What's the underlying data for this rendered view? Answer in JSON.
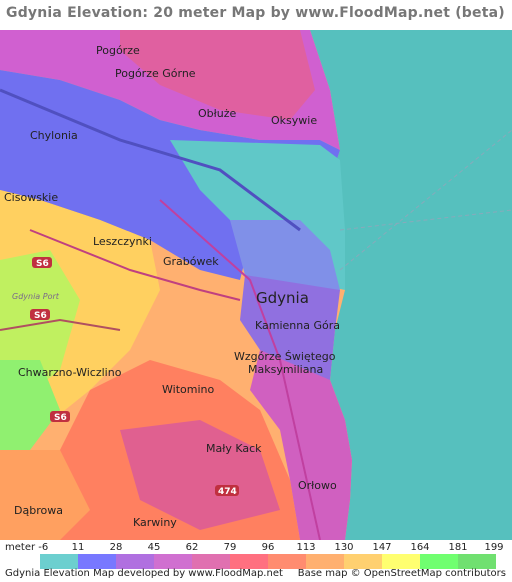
{
  "title": "Gdynia Elevation: 20 meter Map by www.FloodMap.net (beta)",
  "map": {
    "places": [
      {
        "id": "pogorze",
        "label": "Pogórze"
      },
      {
        "id": "pogorze-gorne",
        "label": "Pogórze Górne"
      },
      {
        "id": "obluze",
        "label": "Obłuże"
      },
      {
        "id": "oksywie",
        "label": "Oksywie"
      },
      {
        "id": "chylonia",
        "label": "Chylonia"
      },
      {
        "id": "cisowskie",
        "label": "Cisowskie"
      },
      {
        "id": "leszczynki",
        "label": "Leszczynki"
      },
      {
        "id": "grabowek",
        "label": "Grabówek"
      },
      {
        "id": "gdynia",
        "label": "Gdynia"
      },
      {
        "id": "kamienna-gora",
        "label": "Kamienna Góra"
      },
      {
        "id": "wzgorze-line1",
        "label": "Wzgórze Świętego"
      },
      {
        "id": "wzgorze-line2",
        "label": "Maksymiliana"
      },
      {
        "id": "chwarzno",
        "label": "Chwarzno-Wiczlino"
      },
      {
        "id": "witomino",
        "label": "Witomino"
      },
      {
        "id": "maly-kack",
        "label": "Mały Kack"
      },
      {
        "id": "orlowo",
        "label": "Orłowo"
      },
      {
        "id": "dabrowa",
        "label": "Dąbrowa"
      },
      {
        "id": "karwiny",
        "label": "Karwiny"
      },
      {
        "id": "gdynia-port",
        "label": "Gdynia Port"
      }
    ],
    "road_badges": [
      {
        "id": "s6-a",
        "label": "S6"
      },
      {
        "id": "s6-b",
        "label": "S6"
      },
      {
        "id": "s6-c",
        "label": "S6"
      },
      {
        "id": "r474",
        "label": "474"
      }
    ],
    "osm_badge": "OpenStreetMap"
  },
  "legend": {
    "unit": "meter",
    "values": [
      "-6",
      "11",
      "28",
      "45",
      "62",
      "79",
      "96",
      "113",
      "130",
      "147",
      "164",
      "181",
      "199"
    ],
    "colors": [
      "#6ccfcf",
      "#7878ff",
      "#b070e0",
      "#d070d0",
      "#e070b0",
      "#ff7080",
      "#ff8c70",
      "#ffb070",
      "#ffd070",
      "#ffff70",
      "#70ff70",
      "#70e070"
    ]
  },
  "footer": {
    "left": "Gdynia Elevation Map developed by www.FloodMap.net",
    "right": "Base map © OpenStreetMap contributors"
  }
}
